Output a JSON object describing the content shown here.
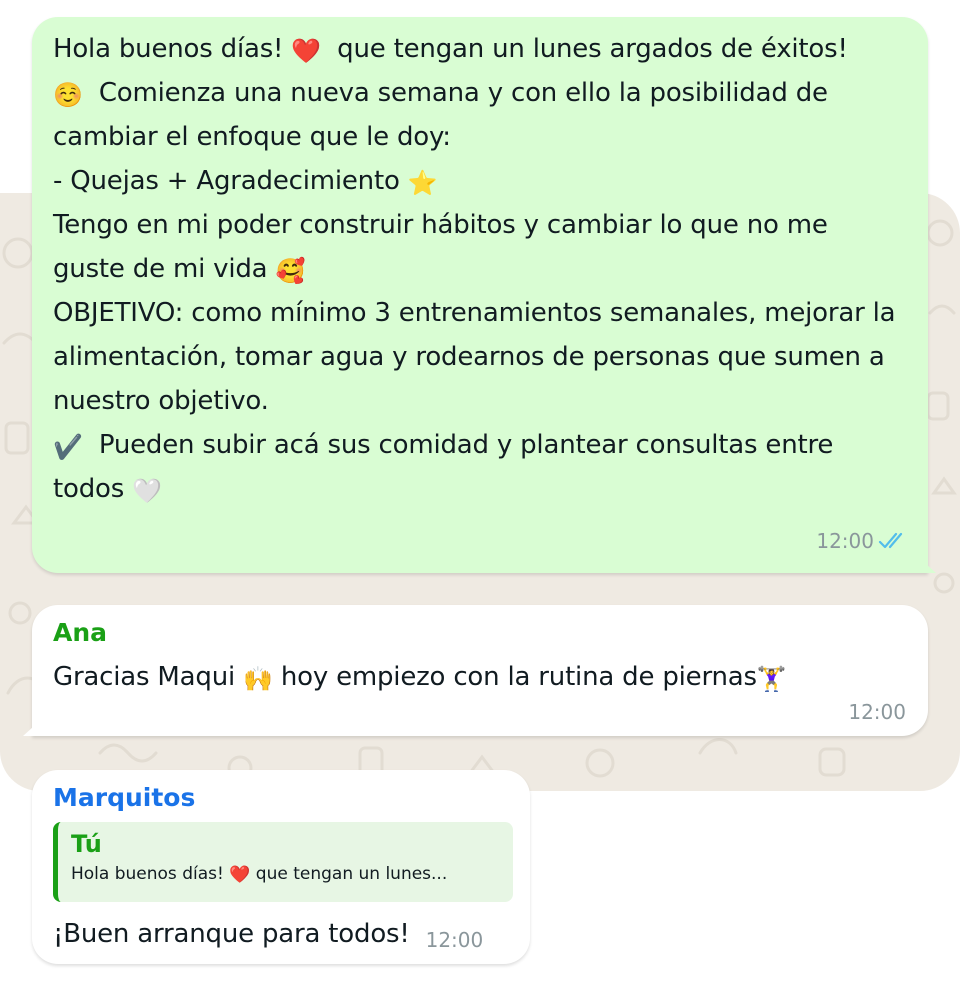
{
  "messages": {
    "outgoing": {
      "text_1": "Hola buenos días! ",
      "emoji_heart": "❤️",
      "text_2": "  que tengan un lunes argados de éxitos!\n",
      "emoji_smile": "☺️",
      "text_3": "  Comienza una nueva semana y con ello la posibilidad de cambiar el enfoque que le doy:\n- Quejas + Agradecimiento ",
      "emoji_star": "⭐",
      "text_4": "\nTengo en mi poder construir hábitos y cambiar lo que no me guste de mi vida ",
      "emoji_hearts_face": "🥰",
      "text_5": "\nOBJETIVO: como mínimo 3 entrenamientos semanales, mejorar la alimentación, tomar agua y rodearnos de personas que sumen a nuestro objetivo.\n",
      "emoji_check": "✔️",
      "text_6": "  Pueden subir acá sus comidad y plantear consultas entre todos ",
      "emoji_white_heart": "🤍",
      "time": "12:00",
      "status": "read",
      "tick_color": "#53bdeb"
    },
    "ana": {
      "sender": "Ana",
      "text_1": "Gracias Maqui ",
      "emoji_hands": "🙌",
      "text_2": " hoy empiezo con la rutina de piernas",
      "emoji_lifter": "🏋️‍♀️",
      "time": "12:00",
      "sender_color": "#1aa016"
    },
    "marquitos": {
      "sender": "Marquitos",
      "sender_color": "#1a73e8",
      "quote": {
        "author": "Tú",
        "text_1": "Hola buenos días! ",
        "emoji_heart": "❤️",
        "text_2": "  que tengan un lunes..."
      },
      "text": "¡Buen arranque para todos!",
      "time": "12:00"
    }
  },
  "colors": {
    "outgoing_bubble": "#d9fdd3",
    "incoming_bubble": "#ffffff",
    "chat_background": "#efeae2",
    "quote_background": "#e7f6e4",
    "timestamp": "#8a969b"
  },
  "icons": {
    "read_receipt": "double-check-icon"
  }
}
